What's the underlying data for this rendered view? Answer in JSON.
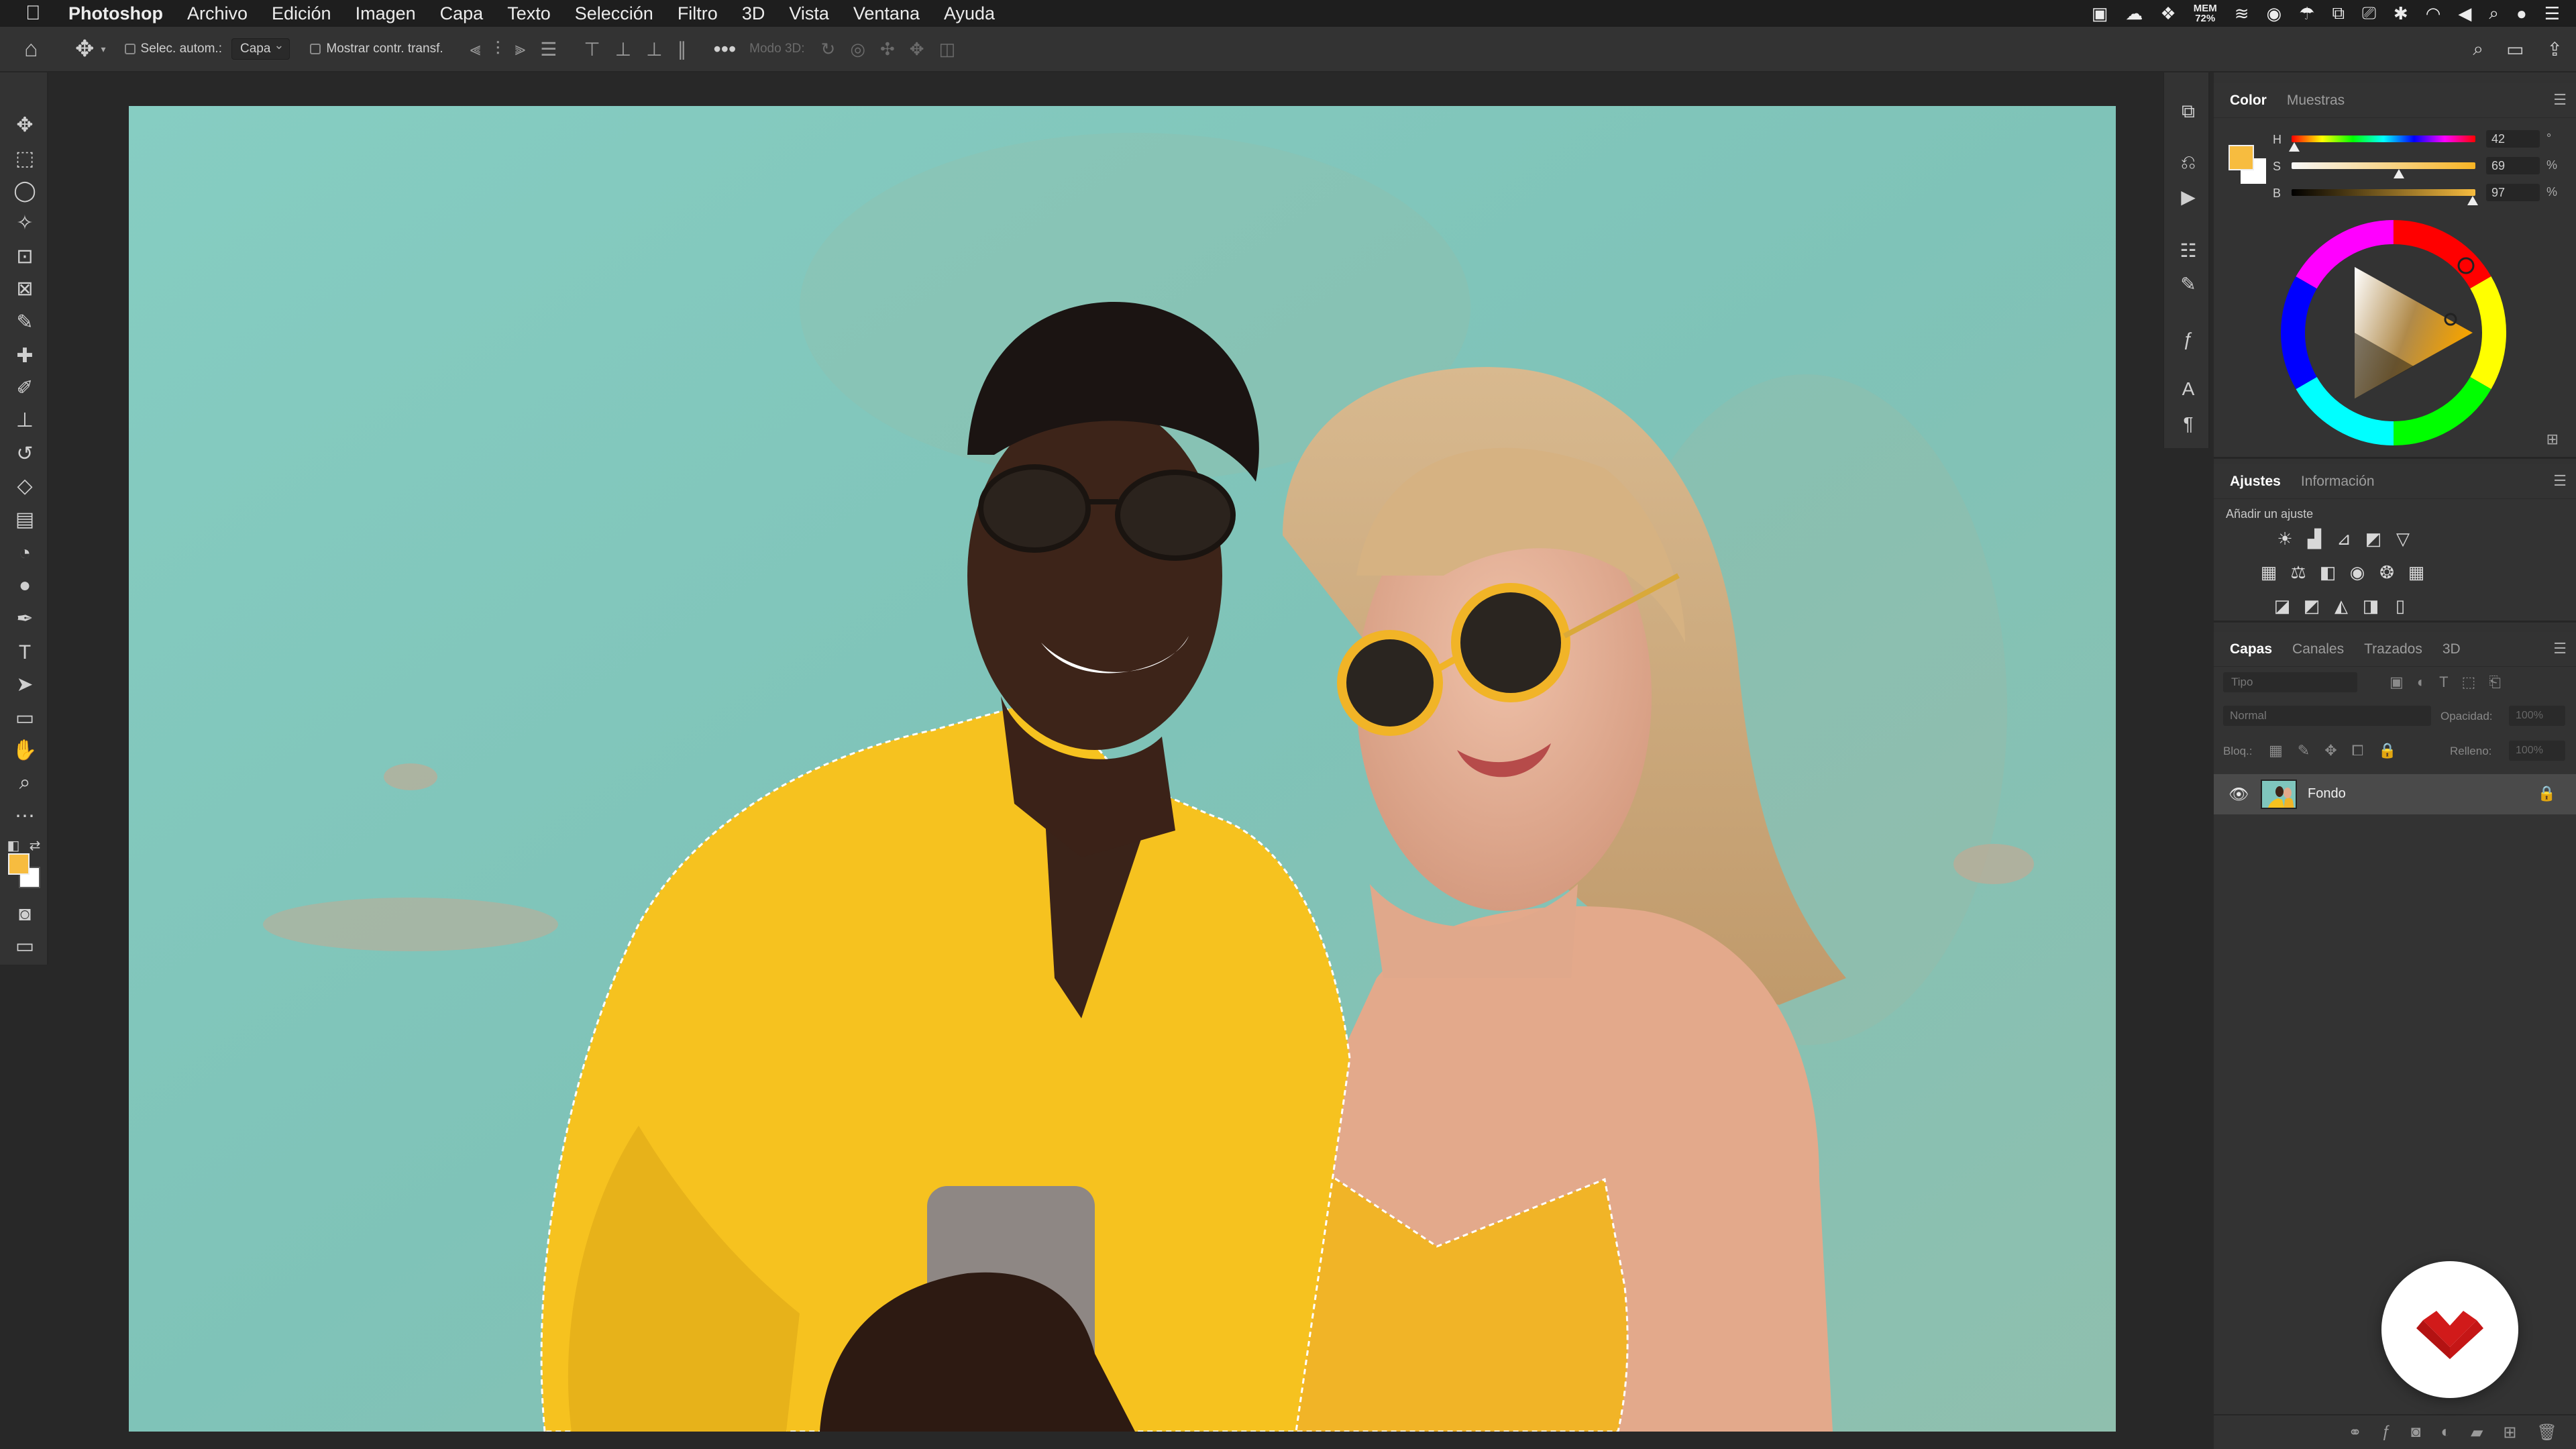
{
  "colors": {
    "accent_yellow": "#F7BC3F",
    "panel_bg": "#333333",
    "canvas_bg": "#282828",
    "wall_teal": "#7FC6BD",
    "brand_red": "#D11A1A"
  },
  "menubar": {
    "apple_icon": "apple-icon",
    "app_name": "Photoshop",
    "items": [
      "Archivo",
      "Edición",
      "Imagen",
      "Capa",
      "Texto",
      "Selección",
      "Filtro",
      "3D",
      "Vista",
      "Ventana",
      "Ayuda"
    ],
    "mem_label": "MEM",
    "mem_value": "72%"
  },
  "options_bar": {
    "auto_select_label": "Selec. autom.:",
    "auto_select_value": "Capa",
    "show_transform_label": "Mostrar contr. transf.",
    "mode3d_label": "Modo 3D:"
  },
  "color_panel": {
    "tabs": [
      "Color",
      "Muestras"
    ],
    "h_label": "H",
    "h_value": "42",
    "h_unit": "°",
    "s_label": "S",
    "s_value": "69",
    "s_unit": "%",
    "b_label": "B",
    "b_value": "97",
    "b_unit": "%"
  },
  "adjustments_panel": {
    "tabs": [
      "Ajustes",
      "Información"
    ],
    "add_label": "Añadir un ajuste"
  },
  "layers_panel": {
    "tabs": [
      "Capas",
      "Canales",
      "Trazados",
      "3D"
    ],
    "search_placeholder": "Tipo",
    "blend_mode": "Normal",
    "opacity_label": "Opacidad:",
    "opacity_value": "100%",
    "lock_label": "Bloq.:",
    "fill_label": "Relleno:",
    "fill_value": "100%",
    "layer_name": "Fondo"
  }
}
